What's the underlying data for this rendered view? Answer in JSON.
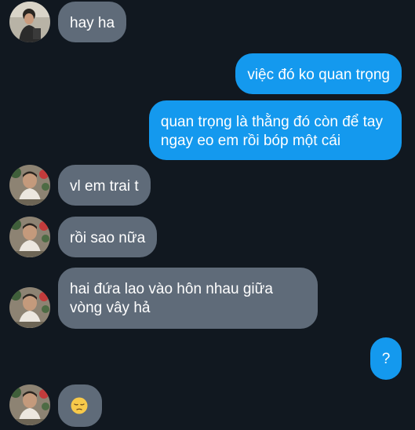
{
  "colors": {
    "background": "#111820",
    "incoming_bubble": "#5f6b79",
    "outgoing_bubble": "#1499ee",
    "text": "#ffffff"
  },
  "messages": [
    {
      "sender": "them",
      "text": "hay ha"
    },
    {
      "sender": "me",
      "text": "việc đó ko quan trọng"
    },
    {
      "sender": "me",
      "line1": "quan trọng là thằng đó còn để tay",
      "line2": "ngay eo em rồi bóp một cái"
    },
    {
      "sender": "them",
      "text": "vl em trai t"
    },
    {
      "sender": "them",
      "text": "rồi sao nữa"
    },
    {
      "sender": "them",
      "line1": "hai đứa lao vào hôn nhau giữa",
      "line2": "vòng vây hả"
    },
    {
      "sender": "me",
      "text": "?"
    },
    {
      "sender": "them",
      "emoji": "pensive-face-emoji"
    }
  ]
}
